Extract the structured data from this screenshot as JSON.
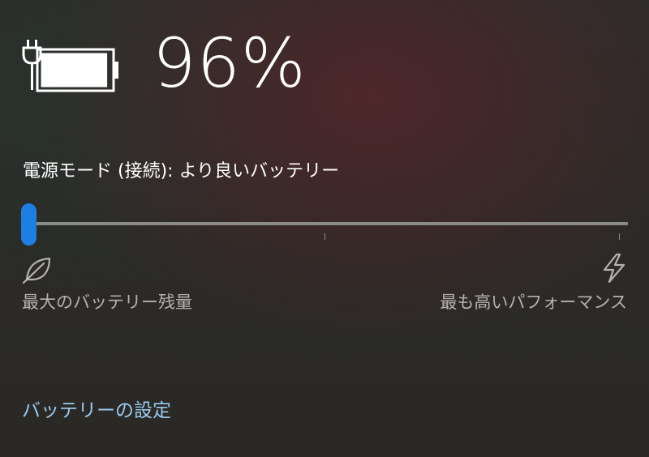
{
  "battery": {
    "icon": "battery-charging-icon",
    "percent_label": "96%",
    "level_percent": 96,
    "charging": true
  },
  "power_mode": {
    "label": "電源モード (接続): より良いバッテリー",
    "slider": {
      "position_index": 0,
      "stops": 3
    },
    "min_label": "最大のバッテリー残量",
    "min_icon": "leaf-icon",
    "max_label": "最も高いパフォーマンス",
    "max_icon": "lightning-icon"
  },
  "settings_link": {
    "label": "バッテリーの設定"
  },
  "colors": {
    "accent": "#1e7fe3",
    "link": "#9bc9ef",
    "secondary_text": "#b5b3ae",
    "track": "#8b8b88"
  }
}
